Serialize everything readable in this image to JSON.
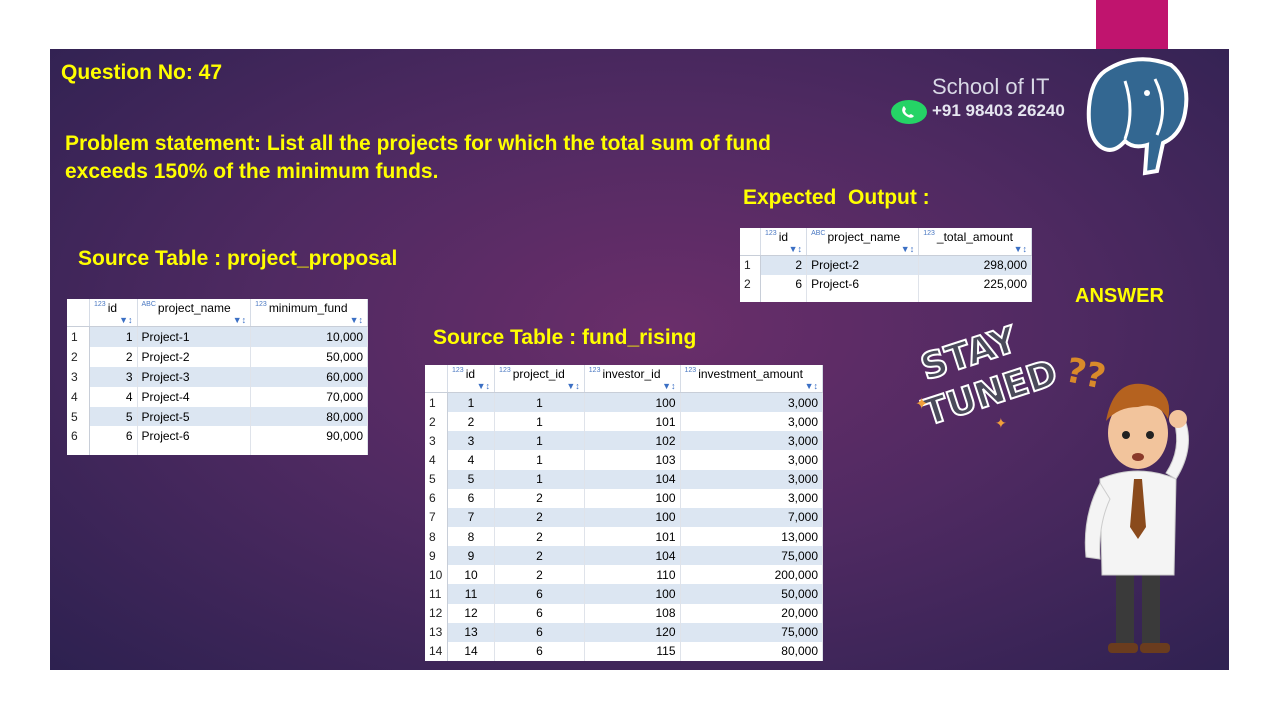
{
  "question": "Question No: 47",
  "brand": {
    "name": "School of IT",
    "phone": "+91 98403 26240"
  },
  "problem": {
    "line1": "Problem statement: List all the projects for which the total sum of fund",
    "line2": "exceeds 150% of the minimum funds."
  },
  "expected_label": "Expected  Output :",
  "answer_label": "ANSWER",
  "stay_tuned": {
    "line1": "STAY",
    "line2": "TUNED"
  },
  "question_marks": "??",
  "project_proposal": {
    "label": "Source Table : project_proposal",
    "headers": [
      "id",
      "project_name",
      "minimum_fund"
    ],
    "header_types": [
      "123",
      "ABC",
      "123"
    ],
    "rows": [
      [
        "1",
        "1",
        "Project-1",
        "10,000"
      ],
      [
        "2",
        "2",
        "Project-2",
        "50,000"
      ],
      [
        "3",
        "3",
        "Project-3",
        "60,000"
      ],
      [
        "4",
        "4",
        "Project-4",
        "70,000"
      ],
      [
        "5",
        "5",
        "Project-5",
        "80,000"
      ],
      [
        "6",
        "6",
        "Project-6",
        "90,000"
      ]
    ]
  },
  "fund_rising": {
    "label": "Source Table : fund_rising",
    "headers": [
      "id",
      "project_id",
      "investor_id",
      "investment_amount"
    ],
    "header_types": [
      "123",
      "123",
      "123",
      "123"
    ],
    "rows": [
      [
        "1",
        "1",
        "1",
        "100",
        "3,000"
      ],
      [
        "2",
        "2",
        "1",
        "101",
        "3,000"
      ],
      [
        "3",
        "3",
        "1",
        "102",
        "3,000"
      ],
      [
        "4",
        "4",
        "1",
        "103",
        "3,000"
      ],
      [
        "5",
        "5",
        "1",
        "104",
        "3,000"
      ],
      [
        "6",
        "6",
        "2",
        "100",
        "3,000"
      ],
      [
        "7",
        "7",
        "2",
        "100",
        "7,000"
      ],
      [
        "8",
        "8",
        "2",
        "101",
        "13,000"
      ],
      [
        "9",
        "9",
        "2",
        "104",
        "75,000"
      ],
      [
        "10",
        "10",
        "2",
        "110",
        "200,000"
      ],
      [
        "11",
        "11",
        "6",
        "100",
        "50,000"
      ],
      [
        "12",
        "12",
        "6",
        "108",
        "20,000"
      ],
      [
        "13",
        "13",
        "6",
        "120",
        "75,000"
      ],
      [
        "14",
        "14",
        "6",
        "115",
        "80,000"
      ]
    ]
  },
  "expected_output": {
    "headers": [
      "id",
      "project_name",
      "_total_amount"
    ],
    "header_types": [
      "123",
      "ABC",
      "123"
    ],
    "rows": [
      [
        "1",
        "2",
        "Project-2",
        "298,000"
      ],
      [
        "2",
        "6",
        "Project-6",
        "225,000"
      ]
    ]
  },
  "colors": {
    "slide_bg": "#502a62",
    "accent_text": "#ffff00",
    "brand_bar": "#c0146e",
    "row_stripe": "#dce6f2"
  }
}
